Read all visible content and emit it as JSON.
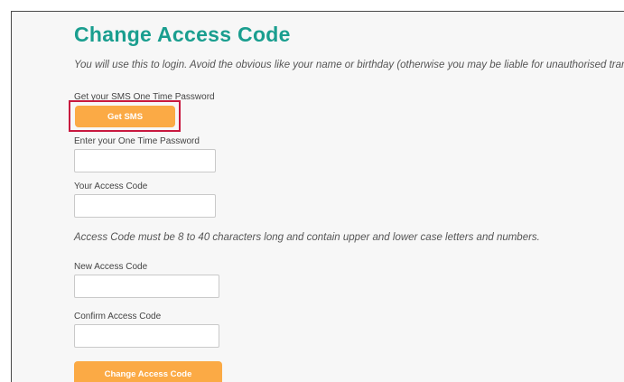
{
  "page": {
    "title": "Change Access Code",
    "intro": "You will use this to login. Avoid the obvious like your name or birthday (otherwise you may be liable for unauthorised transa"
  },
  "otp_section": {
    "label": "Get your SMS One Time Password",
    "button_label": "Get SMS",
    "highlight_color": "#c8183f"
  },
  "form": {
    "otp_label": "Enter your One Time Password",
    "otp_value": "",
    "current_code_label": "Your Access Code",
    "current_code_value": "",
    "rule_text": "Access Code must be 8 to 40 characters long and contain upper and lower case letters and numbers.",
    "new_code_label": "New Access Code",
    "new_code_value": "",
    "confirm_code_label": "Confirm Access Code",
    "confirm_code_value": "",
    "submit_label": "Change Access Code"
  },
  "colors": {
    "title": "#1a9e8f",
    "button": "#fbaa45",
    "page_background": "#f7f7f7"
  }
}
